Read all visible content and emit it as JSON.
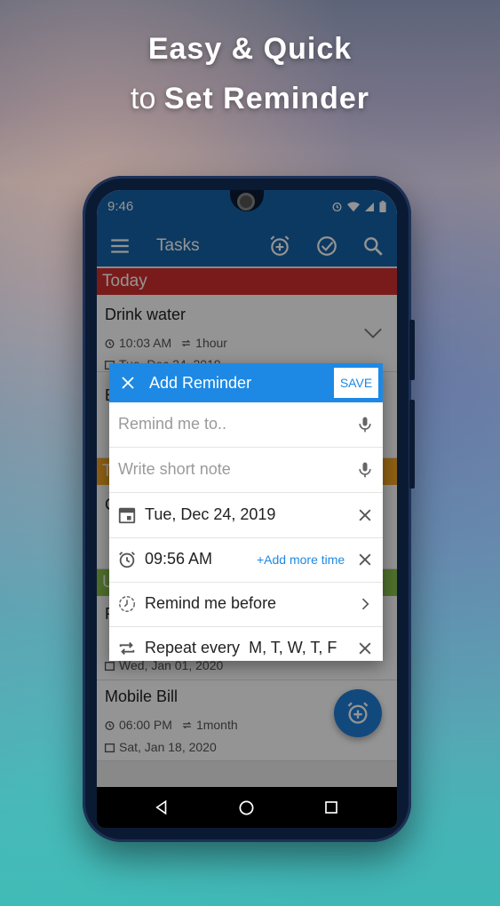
{
  "promo": {
    "line1": "Easy & Quick",
    "line2_prefix": "to ",
    "line2_bold": "Set Reminder"
  },
  "status_bar": {
    "time": "9:46"
  },
  "app_bar": {
    "title": "Tasks"
  },
  "sections": {
    "today": "Today",
    "tomorrow": "T",
    "upcoming": "U"
  },
  "tasks": [
    {
      "name": "Drink water",
      "time": "10:03 AM",
      "repeat": "1hour",
      "date": "Tue, Dec 24, 2019"
    },
    {
      "name": "E"
    },
    {
      "name": "C"
    },
    {
      "name": "P",
      "date": "Wed, Jan 01, 2020"
    },
    {
      "name": "Mobile Bill",
      "time": "06:00 PM",
      "repeat": "1month",
      "date": "Sat, Jan 18, 2020"
    }
  ],
  "dialog": {
    "title": "Add Reminder",
    "save_label": "SAVE",
    "remind_placeholder": "Remind me to..",
    "note_placeholder": "Write short note",
    "date": "Tue, Dec 24, 2019",
    "time": "09:56 AM",
    "add_more_time": "+Add more time",
    "remind_before": "Remind me before",
    "repeat_label": "Repeat every",
    "repeat_days": "M, T, W, T, F"
  },
  "colors": {
    "primary": "#1663a8",
    "dialog_header": "#1d89e4",
    "today_section": "#d32f2f",
    "tomorrow_section": "#f5a623",
    "upcoming_section": "#8bc34a",
    "fab": "#1f7ed8"
  },
  "icons": [
    "menu-icon",
    "add-alarm-icon",
    "check-circle-icon",
    "search-icon",
    "close-icon",
    "mic-icon",
    "calendar-icon",
    "alarm-icon",
    "remind-before-icon",
    "repeat-icon",
    "chevron-right-icon",
    "back-icon",
    "home-icon",
    "recents-icon"
  ]
}
